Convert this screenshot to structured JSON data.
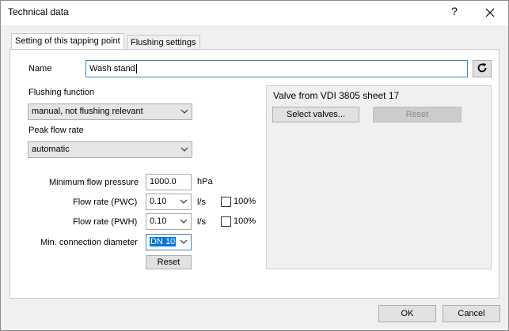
{
  "window": {
    "title": "Technical data",
    "help_label": "?",
    "close_icon": "close-icon"
  },
  "tabs": [
    {
      "label": "Setting of this tapping point",
      "active": true
    },
    {
      "label": "Flushing settings",
      "active": false
    }
  ],
  "form": {
    "name_label": "Name",
    "name_value": "Wash stand",
    "refresh_icon": "refresh-icon",
    "flushing_function_label": "Flushing function",
    "flushing_function_value": "manual, not flushing relevant",
    "peak_flow_label": "Peak flow rate",
    "peak_flow_value": "automatic",
    "min_flow_pressure_label": "Minimum flow pressure",
    "min_flow_pressure_value": "1000.0",
    "min_flow_pressure_unit": "hPa",
    "flow_pwc_label": "Flow rate (PWC)",
    "flow_pwc_value": "0.10",
    "flow_pwc_unit": "l/s",
    "flow_pwc_check_label": "100%",
    "flow_pwh_label": "Flow rate (PWH)",
    "flow_pwh_value": "0.10",
    "flow_pwh_unit": "l/s",
    "flow_pwh_check_label": "100%",
    "min_conn_label": "Min. connection diameter",
    "min_conn_value": "DN 10",
    "reset_label": "Reset"
  },
  "valve_group": {
    "title": "Valve from VDI 3805 sheet 17",
    "select_label": "Select valves...",
    "reset_label": "Reset"
  },
  "footer": {
    "ok_label": "OK",
    "cancel_label": "Cancel"
  }
}
